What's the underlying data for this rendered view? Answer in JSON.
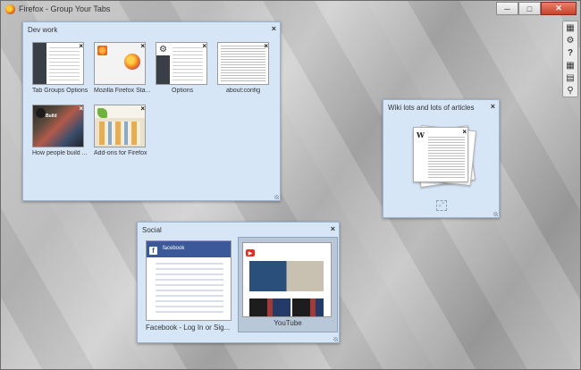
{
  "window": {
    "title": "Firefox - Group Your Tabs",
    "controls": {
      "minimize": "─",
      "maximize": "□",
      "close": "✕"
    }
  },
  "toolbar": {
    "icons": [
      "tab-view-icon",
      "gear-icon",
      "help-icon",
      "group-grid-icon",
      "group-list-icon",
      "search-icon"
    ],
    "glyphs": {
      "tab_view": "▦",
      "gear": "⚙",
      "help": "?",
      "grid": "▦",
      "list": "▤",
      "search": "⚲"
    }
  },
  "groups": {
    "dev": {
      "title": "Dev work",
      "close": "×",
      "tabs": [
        {
          "label": "Tab Groups Options"
        },
        {
          "label": "Mozilla Firefox Sta..."
        },
        {
          "label": "Options"
        },
        {
          "label": "about:config"
        },
        {
          "label": "How people build ..."
        },
        {
          "label": "Add-ons for Firefox"
        }
      ]
    },
    "wiki": {
      "title": "Wiki lots and lots of articles",
      "close": "×"
    },
    "social": {
      "title": "Social",
      "close": "×",
      "tabs": [
        {
          "label": "Facebook - Log In or Sig..."
        },
        {
          "label": "YouTube"
        }
      ]
    }
  },
  "thumbnails": {
    "github_text": "Build",
    "facebook_name": "facebook",
    "wiki_logo": "W",
    "facebook_fav": "f",
    "youtube_fav": "▶"
  },
  "tab_close": "×"
}
